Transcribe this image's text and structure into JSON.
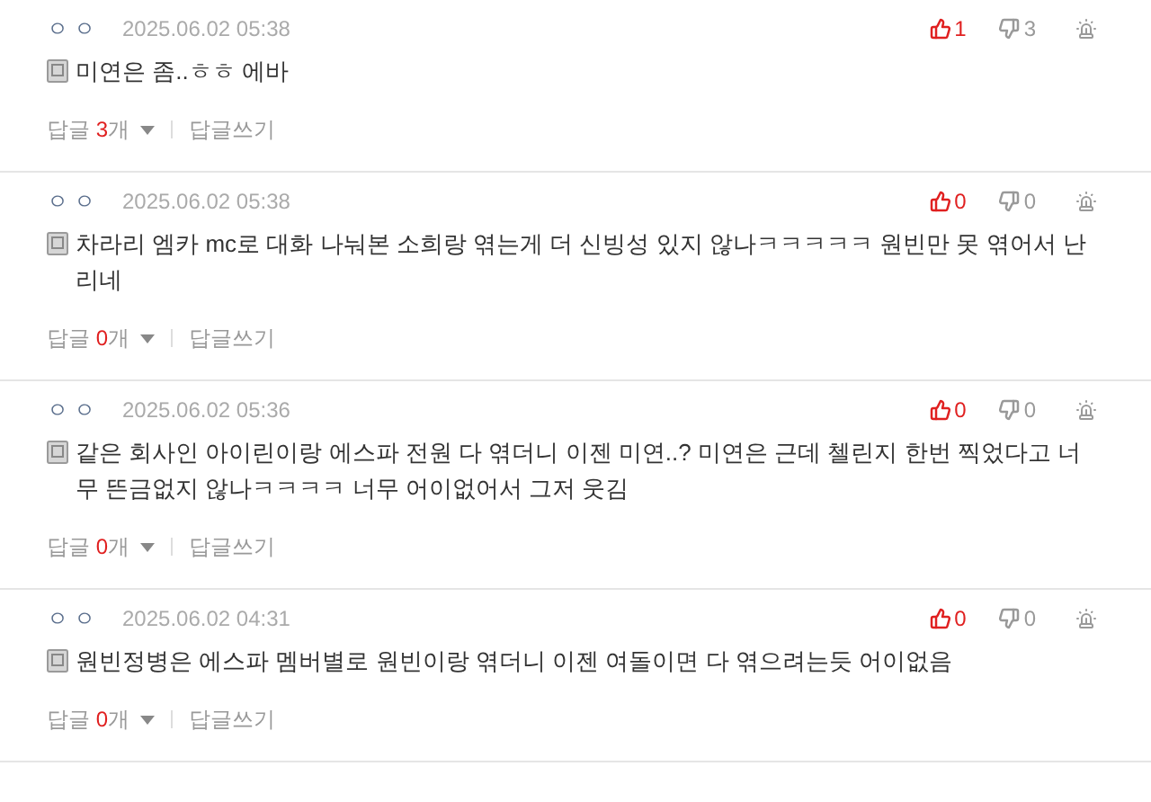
{
  "comments": [
    {
      "author": "ㅇㅇ",
      "date": "2025.06.02 05:38",
      "likes": "1",
      "dislikes": "3",
      "text": "미연은 좀..ㅎㅎ 에바",
      "reply_label": "답글",
      "reply_count": "3",
      "reply_unit": "개",
      "write_reply": "답글쓰기"
    },
    {
      "author": "ㅇㅇ",
      "date": "2025.06.02 05:38",
      "likes": "0",
      "dislikes": "0",
      "text": "차라리 엠카 mc로 대화 나눠본 소희랑 엮는게 더 신빙성 있지 않나ㅋㅋㅋㅋㅋ 원빈만 못 엮어서 난리네",
      "reply_label": "답글",
      "reply_count": "0",
      "reply_unit": "개",
      "write_reply": "답글쓰기"
    },
    {
      "author": "ㅇㅇ",
      "date": "2025.06.02 05:36",
      "likes": "0",
      "dislikes": "0",
      "text": "같은 회사인 아이린이랑 에스파 전원 다 엮더니 이젠 미연..? 미연은 근데 첼린지 한번 찍었다고 너무 뜬금없지 않나ㅋㅋㅋㅋ 너무 어이없어서 그저 웃김",
      "reply_label": "답글",
      "reply_count": "0",
      "reply_unit": "개",
      "write_reply": "답글쓰기"
    },
    {
      "author": "ㅇㅇ",
      "date": "2025.06.02 04:31",
      "likes": "0",
      "dislikes": "0",
      "text": "원빈정병은 에스파 멤버별로 원빈이랑 엮더니 이젠 여돌이면 다 엮으려는듯 어이없음",
      "reply_label": "답글",
      "reply_count": "0",
      "reply_unit": "개",
      "write_reply": "답글쓰기"
    }
  ]
}
